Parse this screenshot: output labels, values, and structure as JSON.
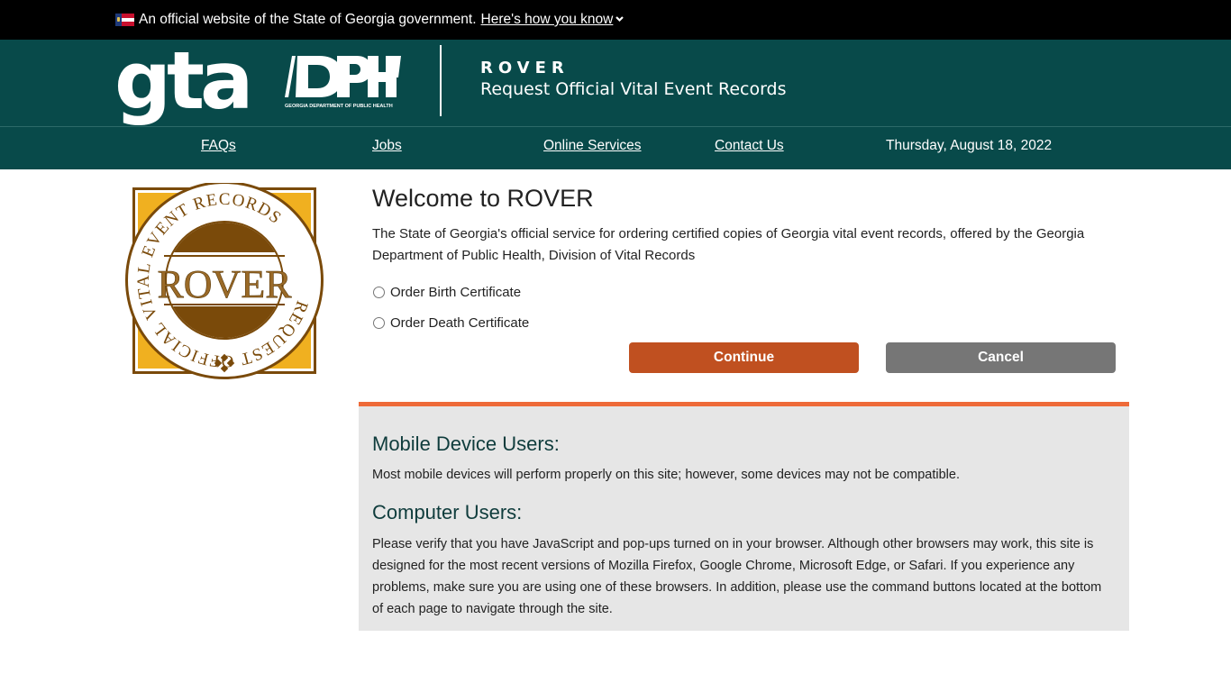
{
  "gov_banner": {
    "text": "An official website of the State of Georgia government.",
    "link": "Here's how you know",
    "flag_icon": "georgia-flag-icon",
    "chevron_icon": "chevron-down-icon"
  },
  "header": {
    "gta_logo": "gta",
    "dph_logo_caption": "GEORGIA DEPARTMENT OF PUBLIC HEALTH",
    "dph_logo_text": "DPH",
    "app_title": "ROVER",
    "app_subtitle": "Request Official Vital Event Records"
  },
  "nav": {
    "items": [
      {
        "label": "FAQs"
      },
      {
        "label": "Jobs"
      },
      {
        "label": "Online Services"
      },
      {
        "label": "Contact Us"
      }
    ],
    "date": "Thursday, August 18, 2022"
  },
  "seal": {
    "center_text": "ROVER",
    "ring_text": "REQUEST OFFICIAL VITAL EVENT RECORDS",
    "colors": {
      "gold": "#f0b020",
      "brown": "#7a4a0a"
    }
  },
  "main": {
    "title": "Welcome to ROVER",
    "intro": "The State of Georgia's official service for ordering certified copies of Georgia vital event records, offered by the Georgia Department of Public Health, Division of Vital Records",
    "options": [
      {
        "label": "Order Birth Certificate",
        "selected": false
      },
      {
        "label": "Order Death Certificate",
        "selected": false
      }
    ],
    "continue_label": "Continue",
    "cancel_label": "Cancel"
  },
  "info": {
    "mobile_heading": "Mobile Device Users:",
    "mobile_text": "Most mobile devices will perform properly on this site; however, some devices may not be compatible.",
    "computer_heading": "Computer Users:",
    "computer_text": "Please verify that you have JavaScript and pop-ups turned on in your browser. Although other browsers may work, this site is designed for the most recent versions of Mozilla Firefox, Google Chrome, Microsoft Edge, or Safari. If you experience any problems, make sure you are using one of these browsers. In addition, please use the command buttons located at the bottom of each page to navigate through the site."
  },
  "colors": {
    "header_bg": "#084a4a",
    "accent_orange": "#ee6a38",
    "continue_bg": "#c05020",
    "cancel_bg": "#767676",
    "info_bg": "#e6e6e6",
    "heading_teal": "#0f3c3c"
  }
}
